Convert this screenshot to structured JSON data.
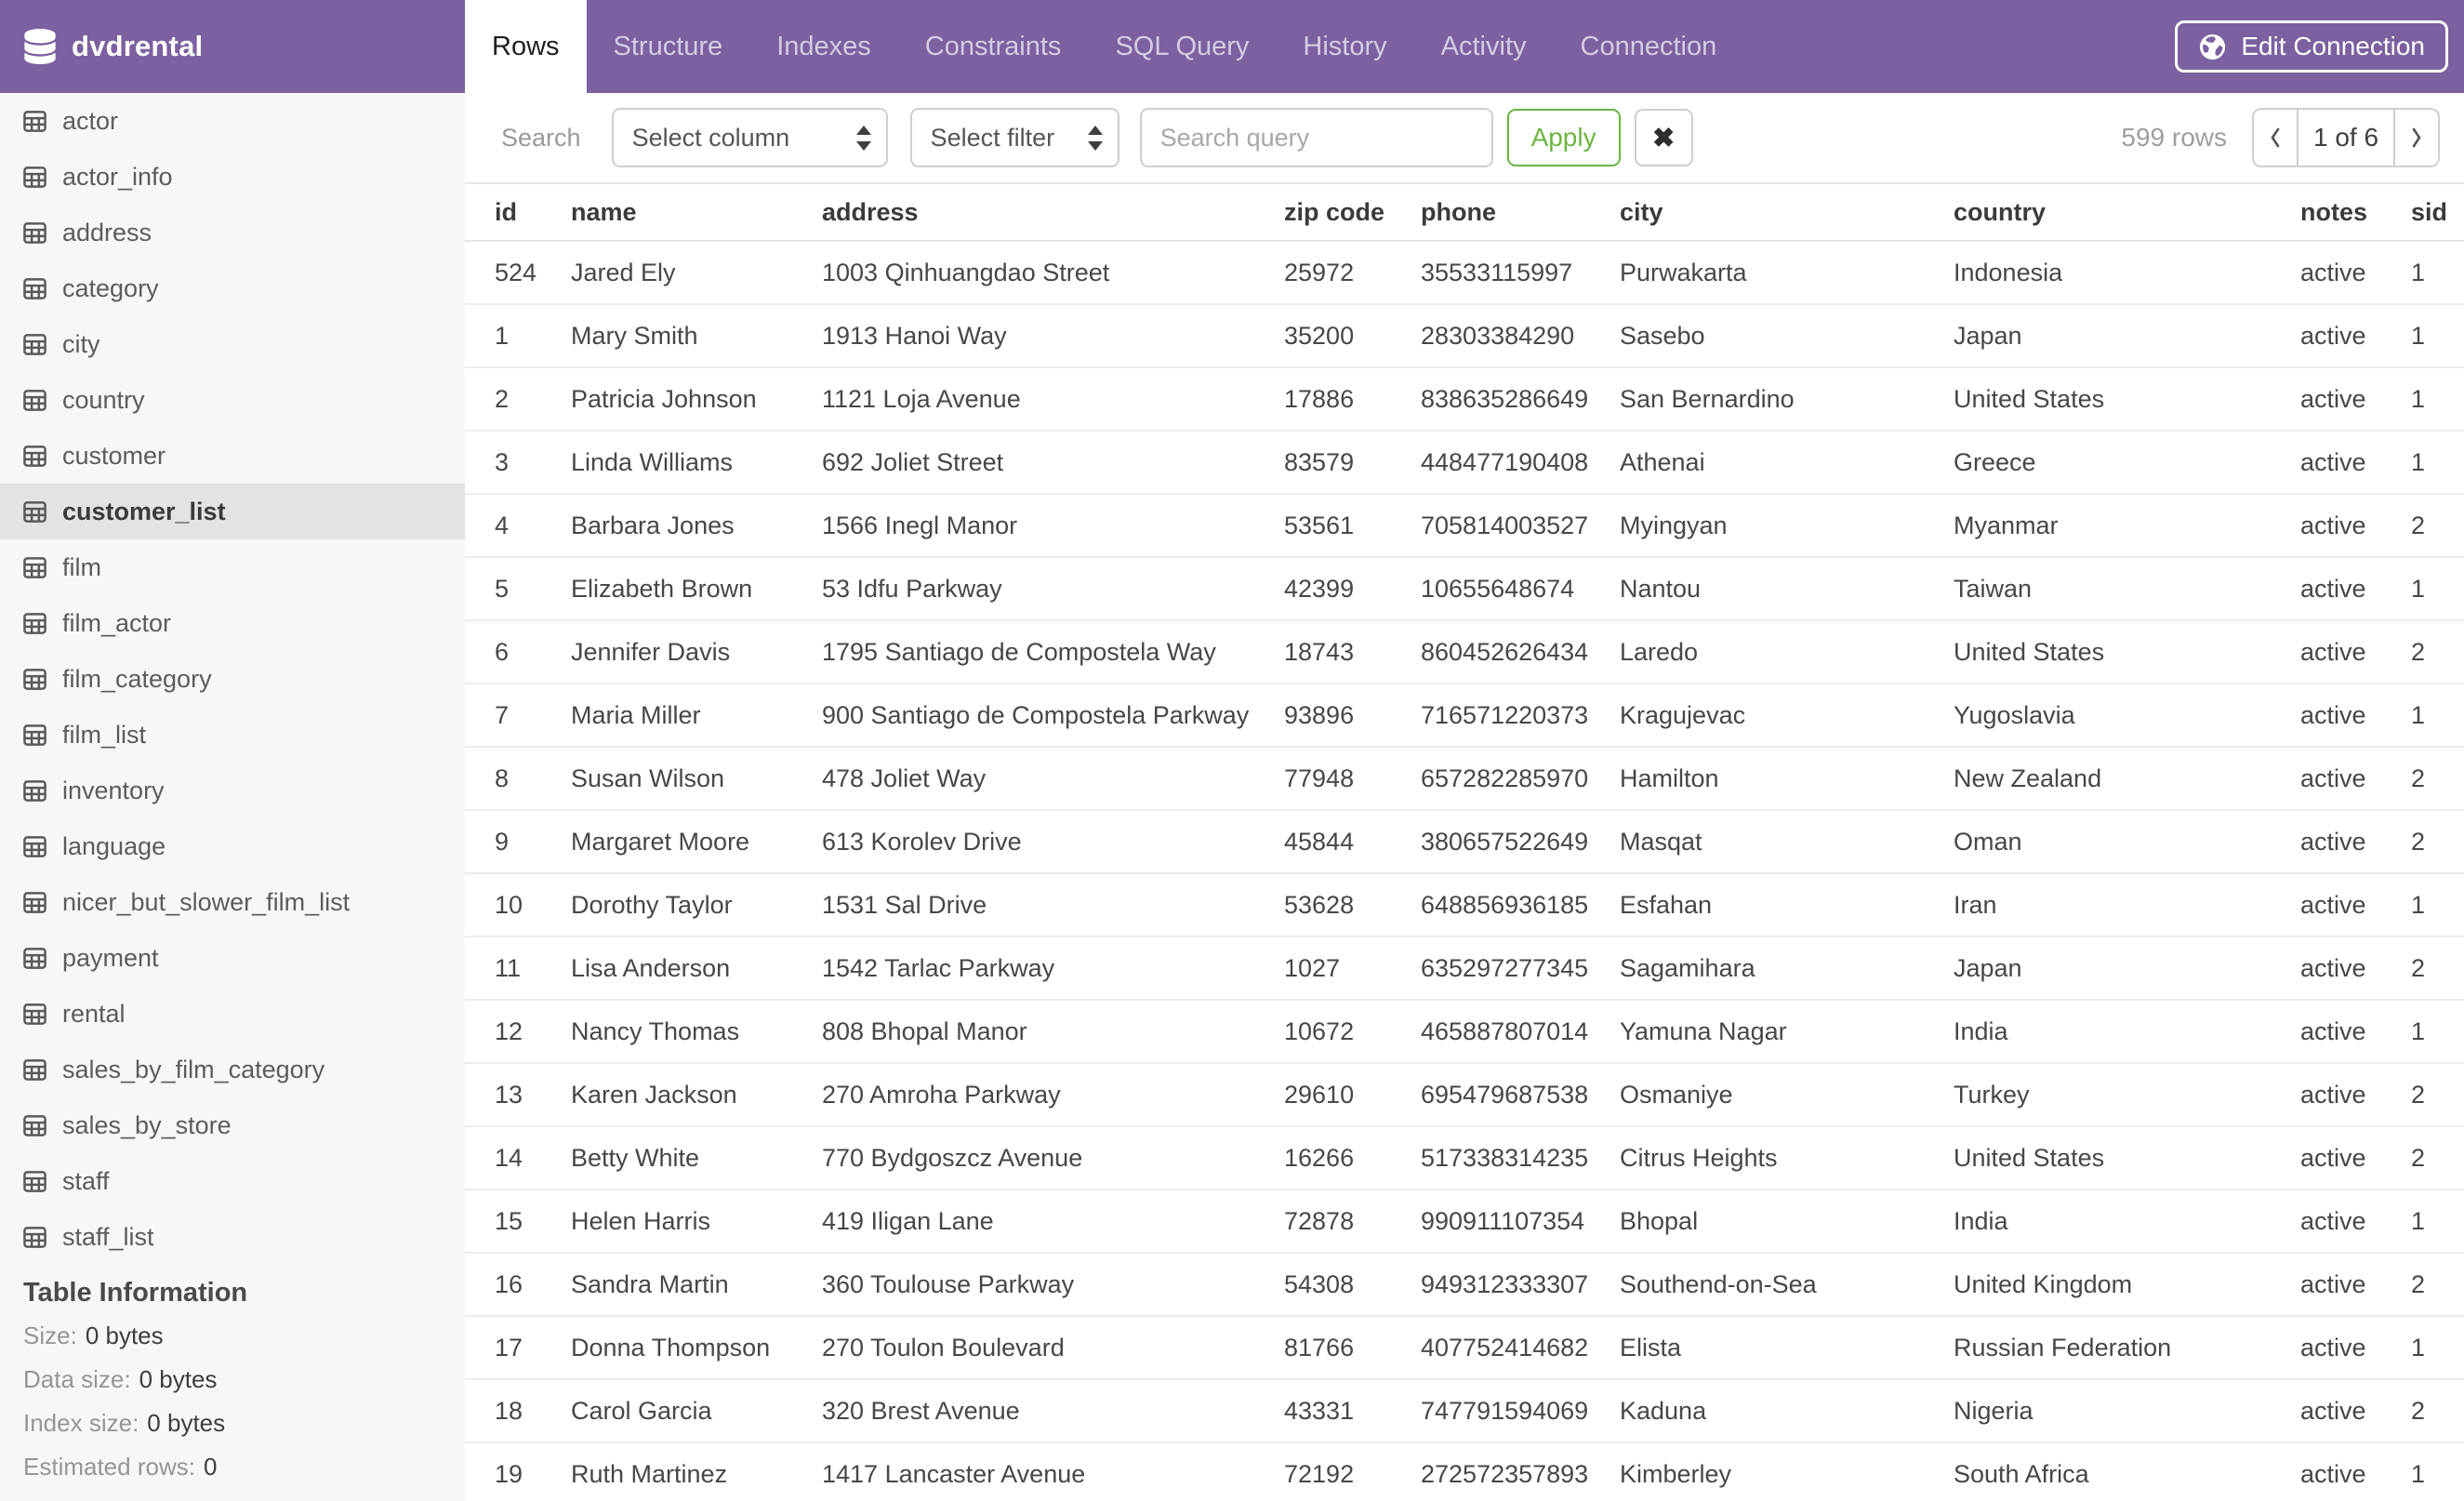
{
  "colors": {
    "accent_purple": "#7B61A0",
    "tab_inactive_text": "#D5CBE6",
    "apply_green": "#6CB43F",
    "sidebar_bg": "#F7F7F7",
    "selected_bg": "#E4E3E3"
  },
  "header": {
    "database_name": "dvdrental",
    "tabs": [
      {
        "label": "Rows",
        "active": true
      },
      {
        "label": "Structure",
        "active": false
      },
      {
        "label": "Indexes",
        "active": false
      },
      {
        "label": "Constraints",
        "active": false
      },
      {
        "label": "SQL Query",
        "active": false
      },
      {
        "label": "History",
        "active": false
      },
      {
        "label": "Activity",
        "active": false
      },
      {
        "label": "Connection",
        "active": false
      }
    ],
    "edit_connection_label": "Edit Connection"
  },
  "sidebar": {
    "tables": [
      "actor",
      "actor_info",
      "address",
      "category",
      "city",
      "country",
      "customer",
      "customer_list",
      "film",
      "film_actor",
      "film_category",
      "film_list",
      "inventory",
      "language",
      "nicer_but_slower_film_list",
      "payment",
      "rental",
      "sales_by_film_category",
      "sales_by_store",
      "staff",
      "staff_list"
    ],
    "selected_table": "customer_list",
    "info": {
      "title": "Table Information",
      "rows": [
        {
          "label": "Size:",
          "value": "0 bytes"
        },
        {
          "label": "Data size:",
          "value": "0 bytes"
        },
        {
          "label": "Index size:",
          "value": "0 bytes"
        },
        {
          "label": "Estimated rows:",
          "value": "0"
        }
      ]
    }
  },
  "toolbar": {
    "search_label": "Search",
    "select_column_value": "Select column",
    "select_filter_value": "Select filter",
    "query_placeholder": "Search query",
    "query_value": "",
    "apply_label": "Apply",
    "clear_glyph": "✖",
    "row_count": "599 rows",
    "page_indicator": "1 of 6"
  },
  "table": {
    "columns": [
      "id",
      "name",
      "address",
      "zip code",
      "phone",
      "city",
      "country",
      "notes",
      "sid"
    ],
    "rows": [
      [
        "524",
        "Jared Ely",
        "1003 Qinhuangdao Street",
        "25972",
        "35533115997",
        "Purwakarta",
        "Indonesia",
        "active",
        "1"
      ],
      [
        "1",
        "Mary Smith",
        "1913 Hanoi Way",
        "35200",
        "28303384290",
        "Sasebo",
        "Japan",
        "active",
        "1"
      ],
      [
        "2",
        "Patricia Johnson",
        "1121 Loja Avenue",
        "17886",
        "838635286649",
        "San Bernardino",
        "United States",
        "active",
        "1"
      ],
      [
        "3",
        "Linda Williams",
        "692 Joliet Street",
        "83579",
        "448477190408",
        "Athenai",
        "Greece",
        "active",
        "1"
      ],
      [
        "4",
        "Barbara Jones",
        "1566 Inegl Manor",
        "53561",
        "705814003527",
        "Myingyan",
        "Myanmar",
        "active",
        "2"
      ],
      [
        "5",
        "Elizabeth Brown",
        "53 Idfu Parkway",
        "42399",
        "10655648674",
        "Nantou",
        "Taiwan",
        "active",
        "1"
      ],
      [
        "6",
        "Jennifer Davis",
        "1795 Santiago de Compostela Way",
        "18743",
        "860452626434",
        "Laredo",
        "United States",
        "active",
        "2"
      ],
      [
        "7",
        "Maria Miller",
        "900 Santiago de Compostela Parkway",
        "93896",
        "716571220373",
        "Kragujevac",
        "Yugoslavia",
        "active",
        "1"
      ],
      [
        "8",
        "Susan Wilson",
        "478 Joliet Way",
        "77948",
        "657282285970",
        "Hamilton",
        "New Zealand",
        "active",
        "2"
      ],
      [
        "9",
        "Margaret Moore",
        "613 Korolev Drive",
        "45844",
        "380657522649",
        "Masqat",
        "Oman",
        "active",
        "2"
      ],
      [
        "10",
        "Dorothy Taylor",
        "1531 Sal Drive",
        "53628",
        "648856936185",
        "Esfahan",
        "Iran",
        "active",
        "1"
      ],
      [
        "11",
        "Lisa Anderson",
        "1542 Tarlac Parkway",
        "1027",
        "635297277345",
        "Sagamihara",
        "Japan",
        "active",
        "2"
      ],
      [
        "12",
        "Nancy Thomas",
        "808 Bhopal Manor",
        "10672",
        "465887807014",
        "Yamuna Nagar",
        "India",
        "active",
        "1"
      ],
      [
        "13",
        "Karen Jackson",
        "270 Amroha Parkway",
        "29610",
        "695479687538",
        "Osmaniye",
        "Turkey",
        "active",
        "2"
      ],
      [
        "14",
        "Betty White",
        "770 Bydgoszcz Avenue",
        "16266",
        "517338314235",
        "Citrus Heights",
        "United States",
        "active",
        "2"
      ],
      [
        "15",
        "Helen Harris",
        "419 Iligan Lane",
        "72878",
        "990911107354",
        "Bhopal",
        "India",
        "active",
        "1"
      ],
      [
        "16",
        "Sandra Martin",
        "360 Toulouse Parkway",
        "54308",
        "949312333307",
        "Southend-on-Sea",
        "United Kingdom",
        "active",
        "2"
      ],
      [
        "17",
        "Donna Thompson",
        "270 Toulon Boulevard",
        "81766",
        "407752414682",
        "Elista",
        "Russian Federation",
        "active",
        "1"
      ],
      [
        "18",
        "Carol Garcia",
        "320 Brest Avenue",
        "43331",
        "747791594069",
        "Kaduna",
        "Nigeria",
        "active",
        "2"
      ],
      [
        "19",
        "Ruth Martinez",
        "1417 Lancaster Avenue",
        "72192",
        "272572357893",
        "Kimberley",
        "South Africa",
        "active",
        "1"
      ]
    ]
  }
}
